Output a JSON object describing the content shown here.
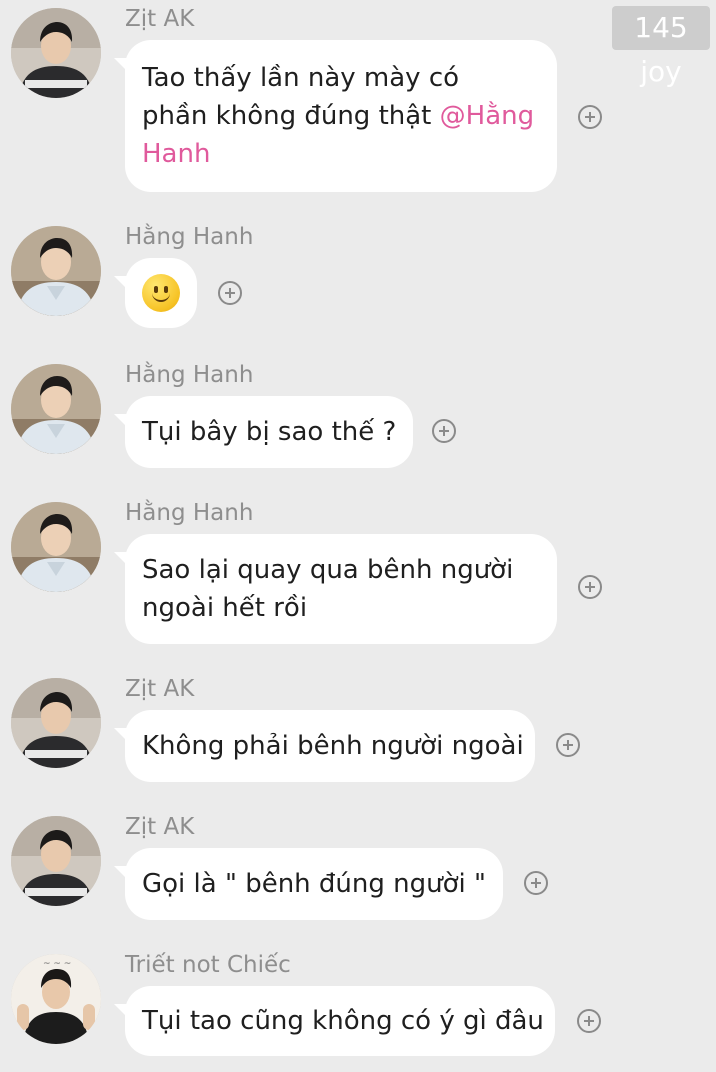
{
  "watermark": "145 joy",
  "messages": [
    {
      "sender": "Zịt AK",
      "avatar_icon": "zit-ak-avatar",
      "lines": [
        "Tao thấy lần này mày có",
        "phần không đúng thật "
      ],
      "mention_inline": "@Hằng",
      "mention_line2": "Hanh"
    },
    {
      "sender": "Hằng Hanh",
      "avatar_icon": "hang-hanh-avatar",
      "emoji": "slightly-smiling-face-emoji"
    },
    {
      "sender": "Hằng Hanh",
      "avatar_icon": "hang-hanh-avatar",
      "lines": [
        "Tụi bây bị sao thế ?"
      ]
    },
    {
      "sender": "Hằng Hanh",
      "avatar_icon": "hang-hanh-avatar",
      "lines": [
        "Sao lại quay qua bênh người",
        "ngoài hết rồi"
      ]
    },
    {
      "sender": "Zịt AK",
      "avatar_icon": "zit-ak-avatar",
      "lines": [
        "Không phải bênh người ngoài"
      ]
    },
    {
      "sender": "Zịt AK",
      "avatar_icon": "zit-ak-avatar",
      "lines": [
        "Gọi là \" bênh đúng người \""
      ]
    },
    {
      "sender": "Triết not Chiếc",
      "avatar_icon": "triet-avatar",
      "lines": [
        "Tụi tao cũng không có ý gì đâu"
      ]
    }
  ],
  "colors": {
    "background": "#ebebeb",
    "bubble": "#ffffff",
    "mention": "#e05a9c",
    "sender_name": "#8e8e8e"
  }
}
